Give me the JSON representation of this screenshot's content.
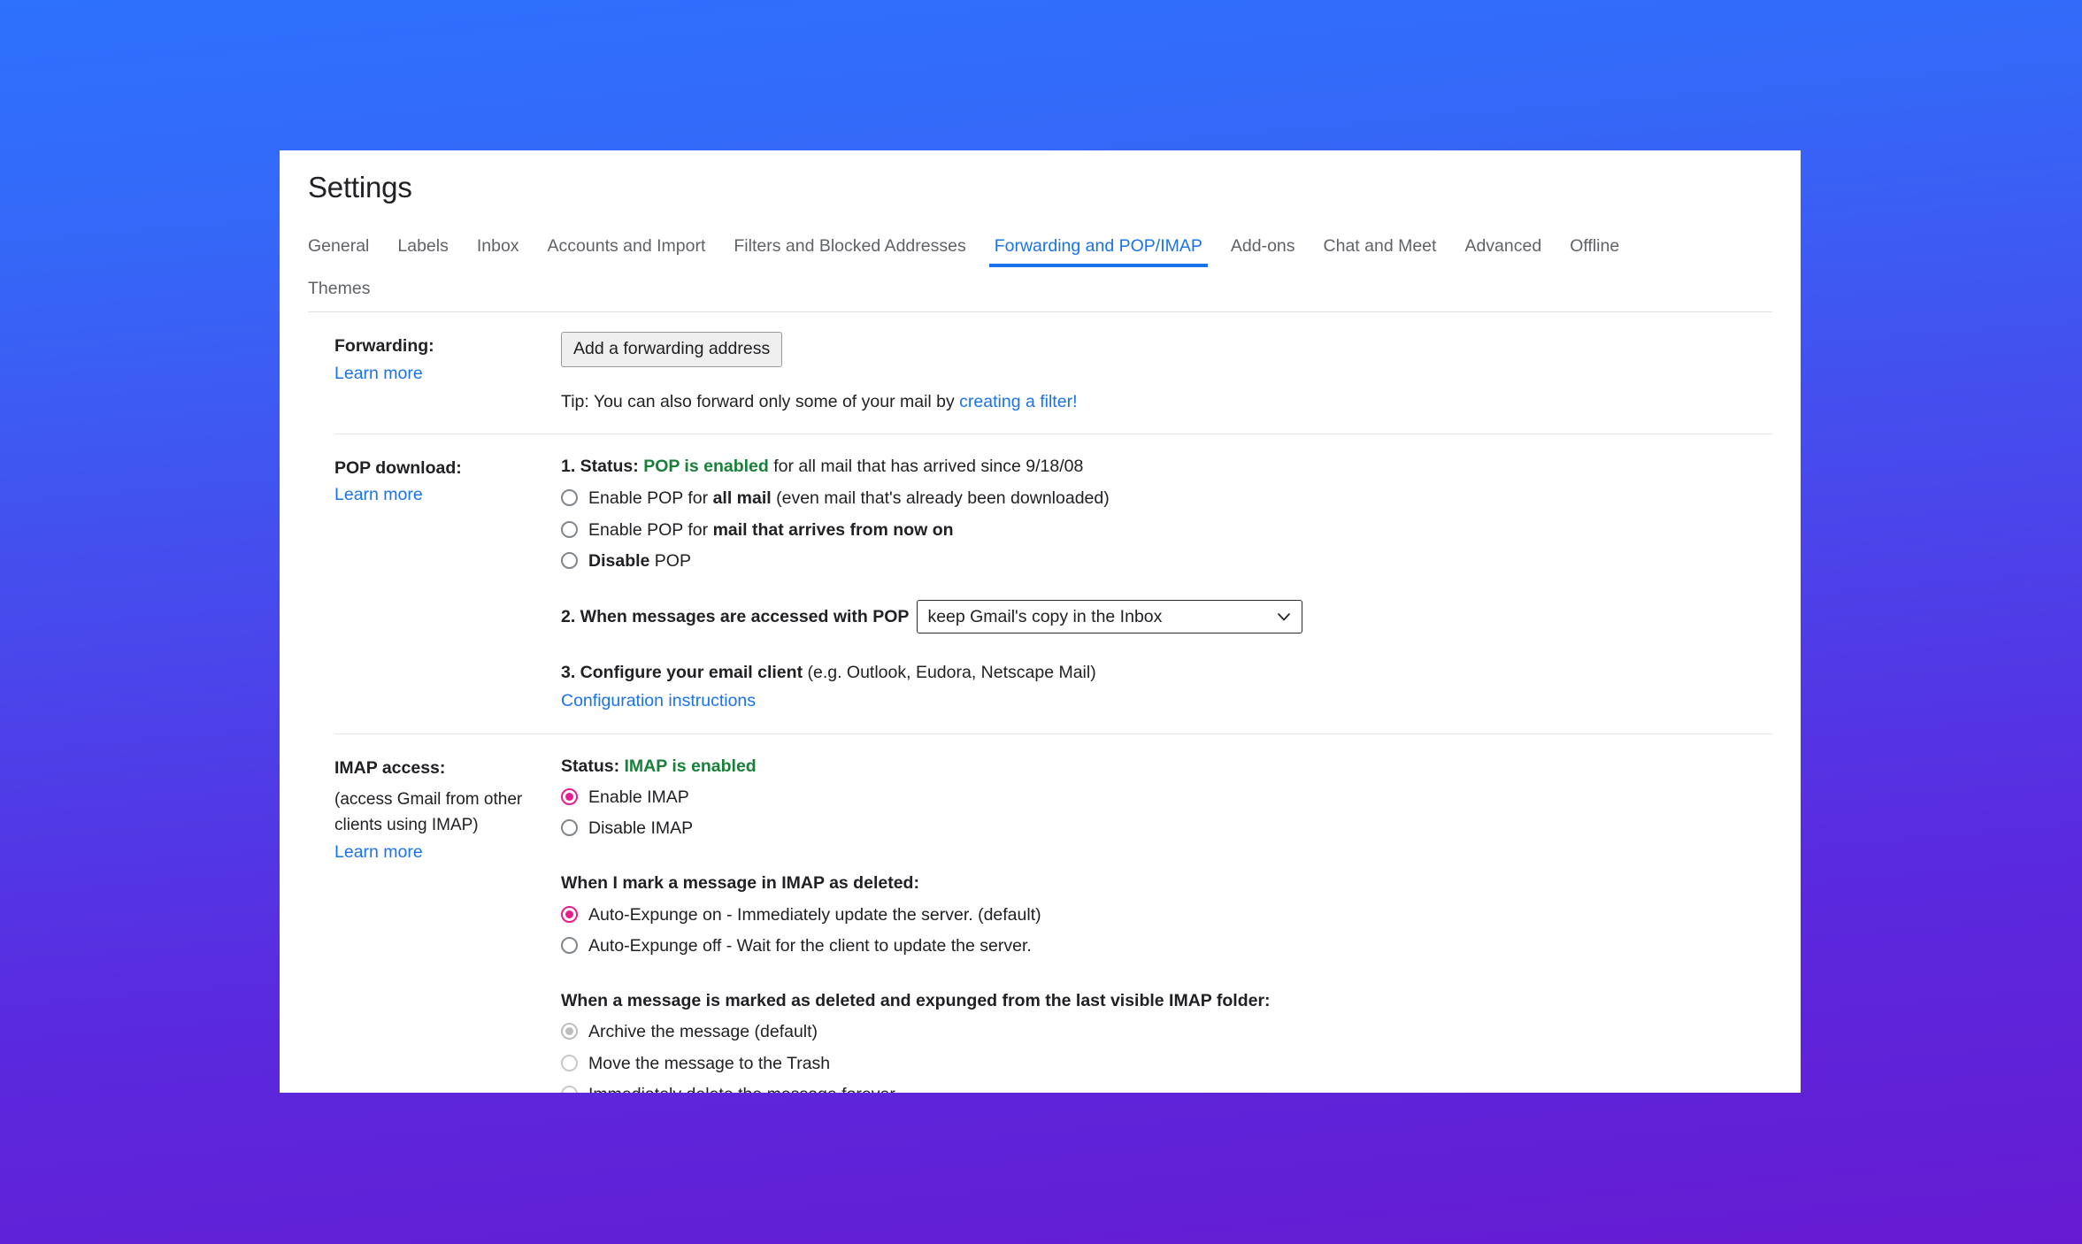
{
  "window": {
    "title": "Settings"
  },
  "tabs": {
    "row1": [
      {
        "label": "General",
        "active": false
      },
      {
        "label": "Labels",
        "active": false
      },
      {
        "label": "Inbox",
        "active": false
      },
      {
        "label": "Accounts and Import",
        "active": false
      },
      {
        "label": "Filters and Blocked Addresses",
        "active": false
      },
      {
        "label": "Forwarding and POP/IMAP",
        "active": true
      },
      {
        "label": "Add-ons",
        "active": false
      },
      {
        "label": "Chat and Meet",
        "active": false
      },
      {
        "label": "Advanced",
        "active": false
      },
      {
        "label": "Offline",
        "active": false
      }
    ],
    "row2": [
      {
        "label": "Themes",
        "active": false
      }
    ]
  },
  "forwarding": {
    "label": "Forwarding:",
    "learn_more": "Learn more",
    "add_button": "Add a forwarding address",
    "tip_prefix": "Tip: You can also forward only some of your mail by ",
    "tip_link": "creating a filter!"
  },
  "pop": {
    "label": "POP download:",
    "learn_more": "Learn more",
    "step1_prefix": "1. Status: ",
    "step1_status": "POP is enabled",
    "step1_suffix": " for all mail that has arrived since 9/18/08",
    "options": [
      {
        "pre": "Enable POP for ",
        "strong": "all mail",
        "post": " (even mail that's already been downloaded)",
        "checked": false
      },
      {
        "pre": "Enable POP for ",
        "strong": "mail that arrives from now on",
        "post": "",
        "checked": false
      },
      {
        "pre": "",
        "strong": "Disable",
        "post": " POP",
        "checked": false
      }
    ],
    "step2_label": "2. When messages are accessed with POP",
    "step2_select_value": "keep Gmail's copy in the Inbox",
    "step3_strong": "3. Configure your email client",
    "step3_rest": " (e.g. Outlook, Eudora, Netscape Mail)",
    "step3_link": "Configuration instructions"
  },
  "imap": {
    "label": "IMAP access:",
    "note": "(access Gmail from other clients using IMAP)",
    "learn_more": "Learn more",
    "status_prefix": "Status: ",
    "status_value": "IMAP is enabled",
    "enable_options": [
      {
        "label": "Enable IMAP",
        "checked": true
      },
      {
        "label": "Disable IMAP",
        "checked": false
      }
    ],
    "expunge_heading": "When I mark a message in IMAP as deleted:",
    "expunge_options": [
      {
        "label": "Auto-Expunge on - Immediately update the server. (default)",
        "checked": true
      },
      {
        "label": "Auto-Expunge off - Wait for the client to update the server.",
        "checked": false
      }
    ],
    "deleted_heading": "When a message is marked as deleted and expunged from the last visible IMAP folder:",
    "deleted_options": [
      {
        "label": "Archive the message (default)",
        "checked": true,
        "disabled": true
      },
      {
        "label": "Move the message to the Trash",
        "checked": false,
        "disabled": true
      },
      {
        "label": "Immediately delete the message forever",
        "checked": false,
        "disabled": true
      }
    ]
  },
  "colors": {
    "accent_blue": "#1a73e8",
    "status_green": "#188038",
    "radio_pink": "#e91e8c",
    "bg_top": "#2d71fd",
    "bg_bottom": "#661bd2"
  }
}
